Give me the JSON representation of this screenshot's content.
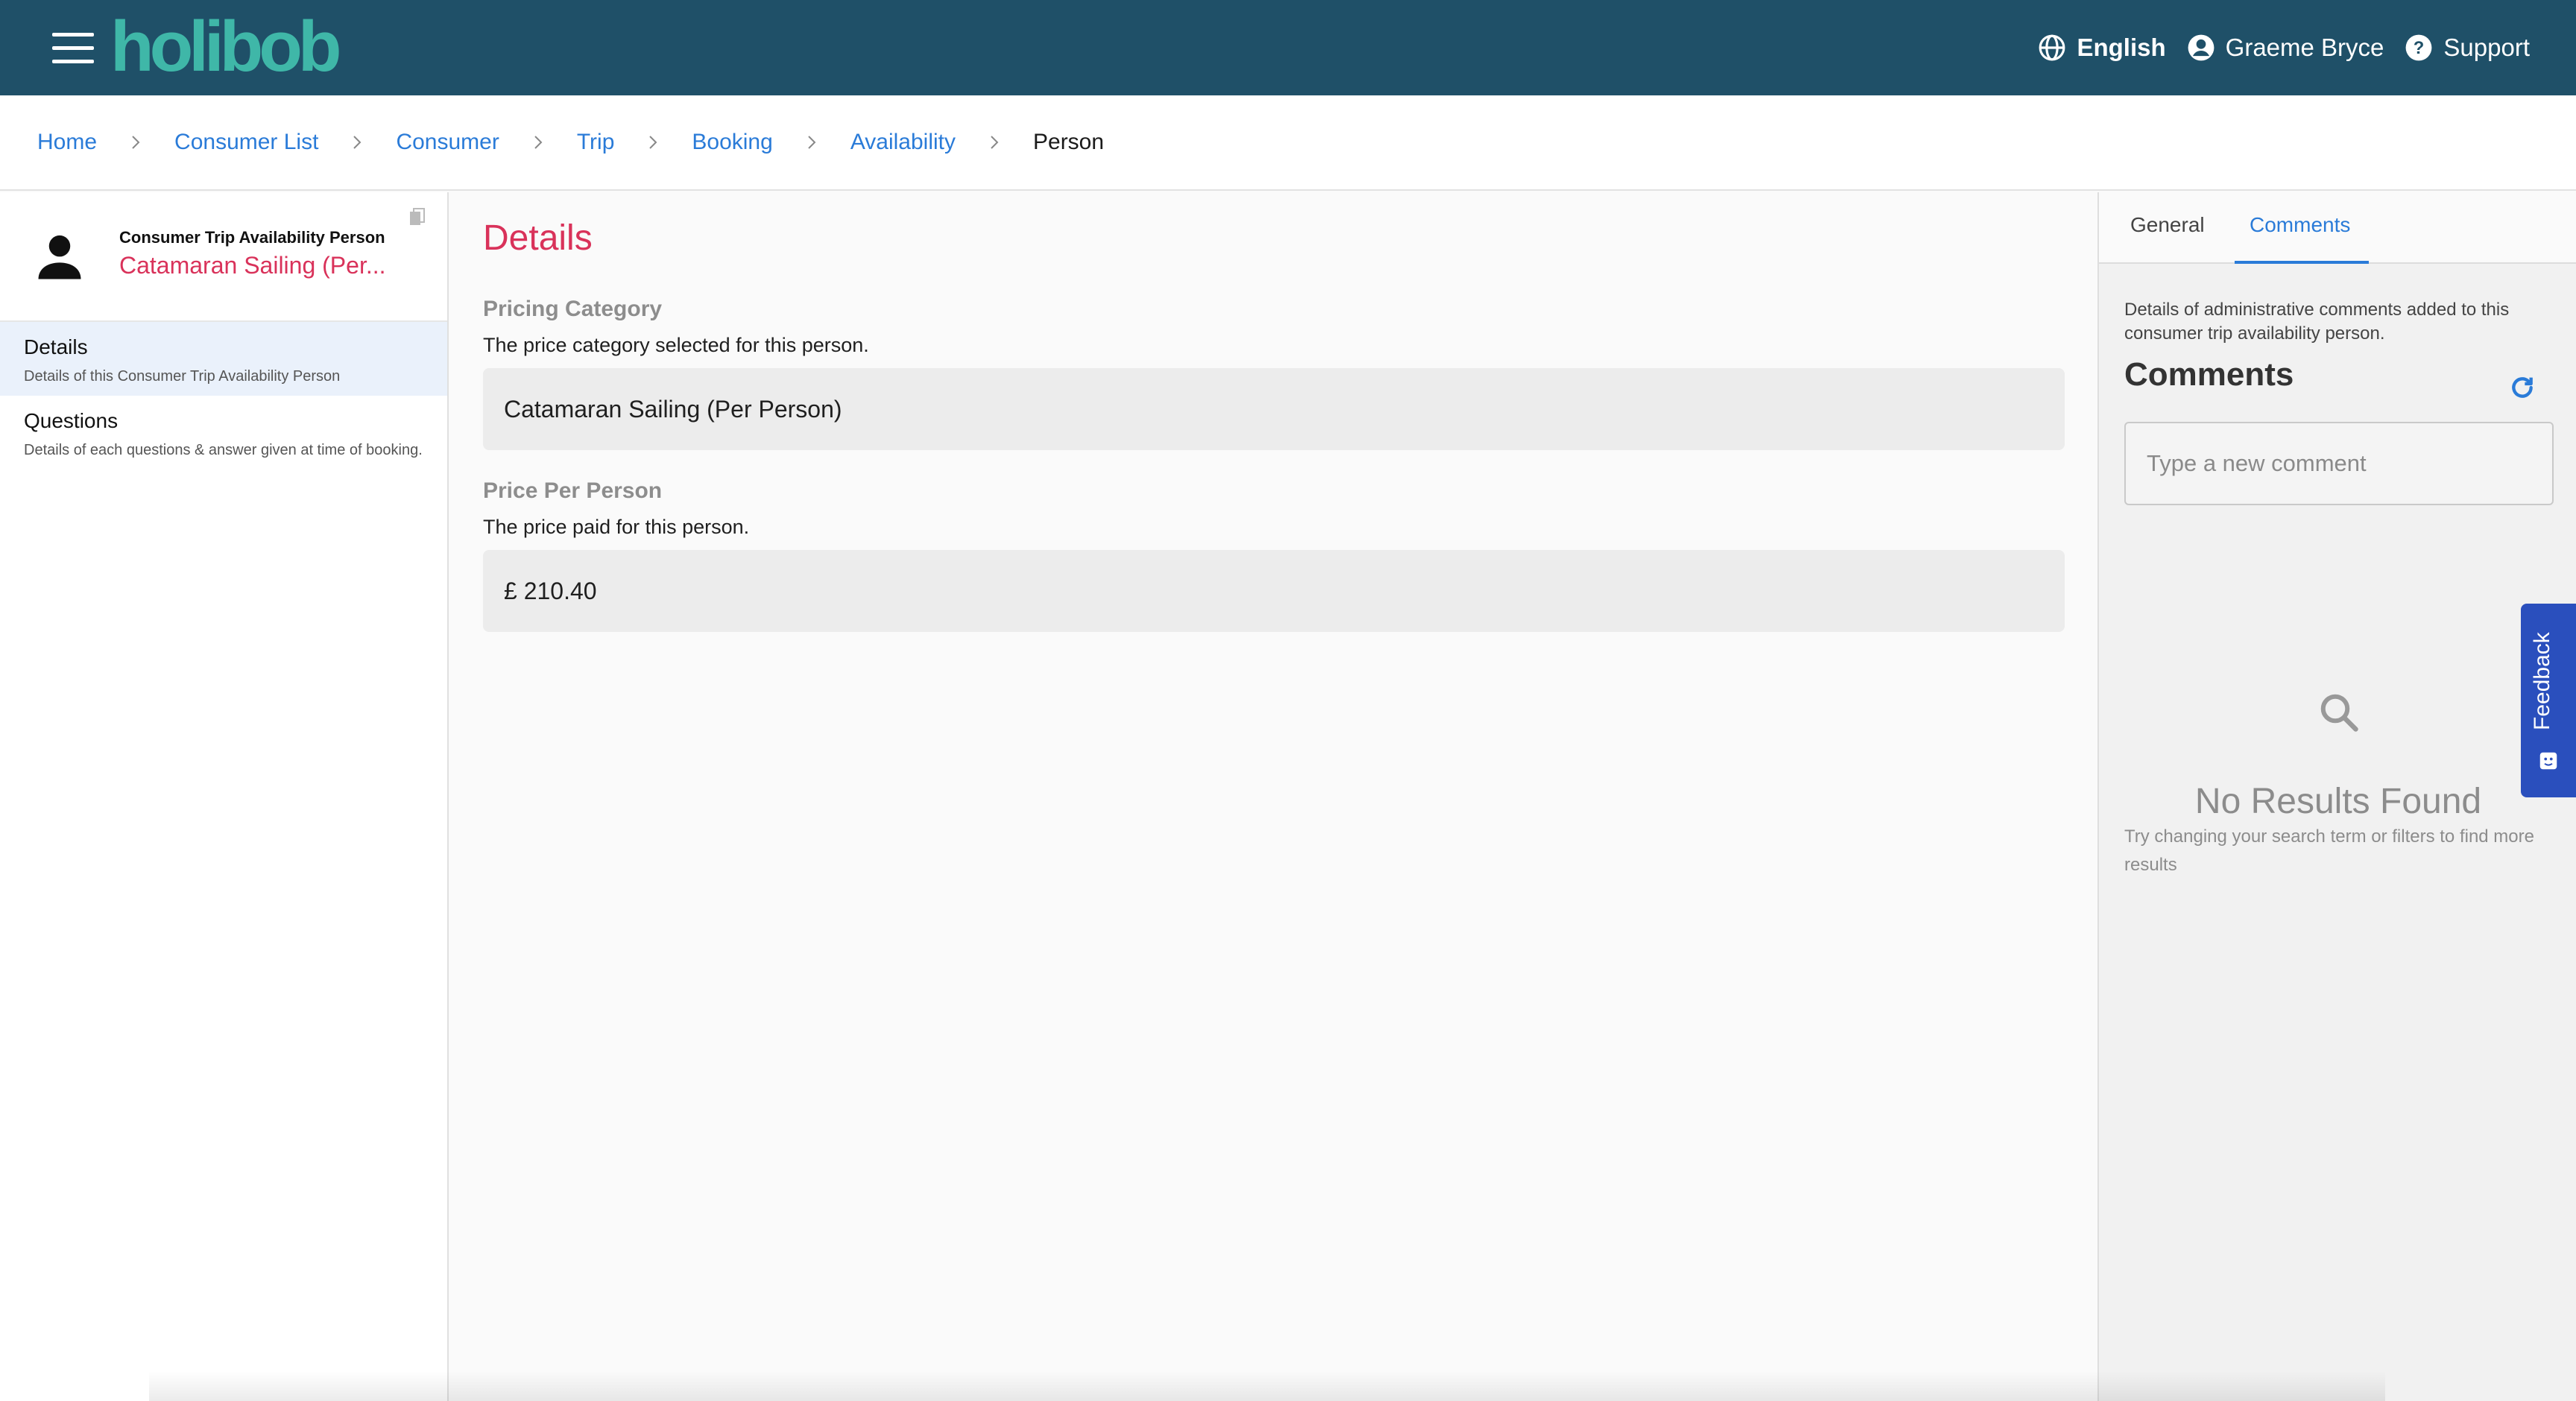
{
  "header": {
    "logo_text": "holibob",
    "language": "English",
    "user_name": "Graeme Bryce",
    "support": "Support",
    "brand_color": "#1f5068",
    "logo_color": "#3fb7a8"
  },
  "breadcrumb": [
    "Home",
    "Consumer List",
    "Consumer",
    "Trip",
    "Booking",
    "Availability",
    "Person"
  ],
  "sidebar": {
    "entity_label": "Consumer Trip Availability Person",
    "entity_name": "Catamaran Sailing (Per...",
    "items": [
      {
        "title": "Details",
        "desc": "Details of this Consumer Trip Availability Person"
      },
      {
        "title": "Questions",
        "desc": "Details of each questions & answer given at time of booking."
      }
    ]
  },
  "main": {
    "title": "Details",
    "fields": [
      {
        "label": "Pricing Category",
        "desc": "The price category selected for this person.",
        "value": "Catamaran Sailing (Per Person)"
      },
      {
        "label": "Price Per Person",
        "desc": "The price paid for this person.",
        "value": "£ 210.40"
      }
    ]
  },
  "right_panel": {
    "tabs": [
      "General",
      "Comments"
    ],
    "active_tab": "Comments",
    "description": "Details of administrative comments added to this consumer trip availability person.",
    "heading": "Comments",
    "input_placeholder": "Type a new comment",
    "empty_title": "No Results Found",
    "empty_desc": "Try changing your search term or filters to find more results"
  },
  "feedback": {
    "label": "Feedback",
    "color": "#2a4fbd"
  },
  "icons": [
    "menu-icon",
    "globe-icon",
    "user-circle-icon",
    "help-icon",
    "chevron-right-icon",
    "person-icon",
    "copy-icon",
    "refresh-icon",
    "search-icon",
    "feedback-icon"
  ]
}
